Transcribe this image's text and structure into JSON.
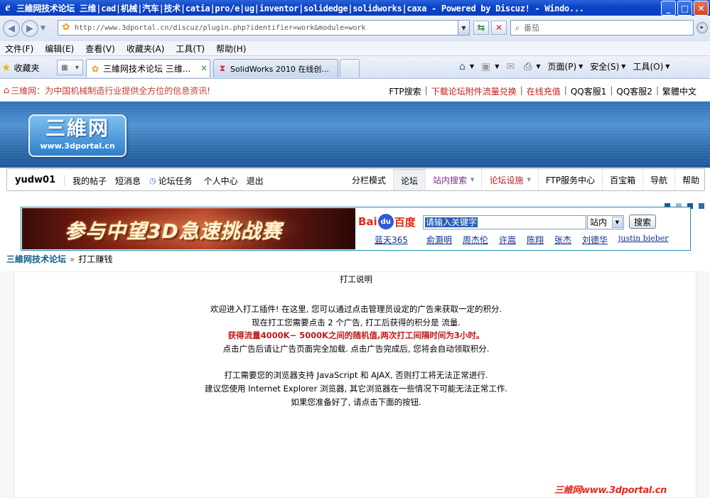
{
  "window": {
    "title": "三維网技术论坛 三维|cad|机械|汽车|技术|catia|pro/e|ug|inventor|solidedge|solidworks|caxa - Powered by Discuz! - Windo...",
    "min": "_",
    "max": "□",
    "close": "✕"
  },
  "address": {
    "url": "http://www.3dportal.cn/discuz/plugin.php?identifier=work&module=work",
    "search_placeholder": "番茄"
  },
  "menu": [
    "文件(F)",
    "编辑(E)",
    "查看(V)",
    "收藏夹(A)",
    "工具(T)",
    "帮助(H)"
  ],
  "tabs": {
    "favorites": "收藏夹",
    "active": "三維网技术论坛 三维...",
    "inactive": "SolidWorks 2010 在线创..."
  },
  "commands": {
    "page": "页面(P)",
    "safety": "安全(S)",
    "tools": "工具(O)"
  },
  "site": {
    "slogan": "三維网：为中国机械制造行业提供全方位的信息资讯!",
    "toplinks": [
      "FTP搜索",
      "下载论坛附件流量兑换",
      "在线充值",
      "QQ客服1",
      "QQ客服2",
      "繁體中文"
    ],
    "logo_cn": "三維网",
    "logo_en": "www.3dportal.cn"
  },
  "nav": {
    "user": "yudw01",
    "left": [
      "我的帖子",
      "短消息",
      "论坛任务",
      "个人中心",
      "退出"
    ],
    "right": [
      "分栏模式",
      "论坛",
      "站内搜索",
      "论坛设施",
      "FTP服务中心",
      "百宝箱",
      "导航",
      "帮助"
    ]
  },
  "ad": {
    "banner_text": "参与中望3D急速挑战赛",
    "baidu_text1": "Bai",
    "baidu_du": "du",
    "baidu_text2": "百度",
    "search_value": "请输入关键字",
    "select_value": "站内",
    "button": "搜索",
    "links": [
      "蓝天365",
      "俞灏明",
      "周杰伦",
      "许嵩",
      "陈翔",
      "张杰",
      "刘德华",
      "justin bieber"
    ]
  },
  "breadcrumb": {
    "home": "三維网技术论坛",
    "current": "打工赚钱"
  },
  "content": {
    "title": "打工说明",
    "lines": [
      "欢迎进入打工插件! 在这里, 您可以通过点击管理员设定的广告来获取一定的积分.",
      "现在打工您需要点击  2 个广告, 打工后获得的积分是  流量.",
      "获得流量4000K− 5000K之间的随机值,两次打工间隔时间为3小时。",
      "点击广告后请让广告页面完全加载. 点击广告完成后, 您将会自动领取积分.",
      "打工需要您的浏览器支持  JavaScript 和  AJAX, 否则打工将无法正常进行.",
      "建议您使用  Internet Explorer 浏览器, 其它浏览器在一些情况下可能无法正常工作.",
      "如果您准备好了, 请点击下面的按钮."
    ]
  },
  "watermark": "三維网www.3dportal.cn",
  "colors": {
    "accent_red": "#c01818",
    "link_blue": "#0b2f8e",
    "header_blue": "#2f70b6"
  }
}
